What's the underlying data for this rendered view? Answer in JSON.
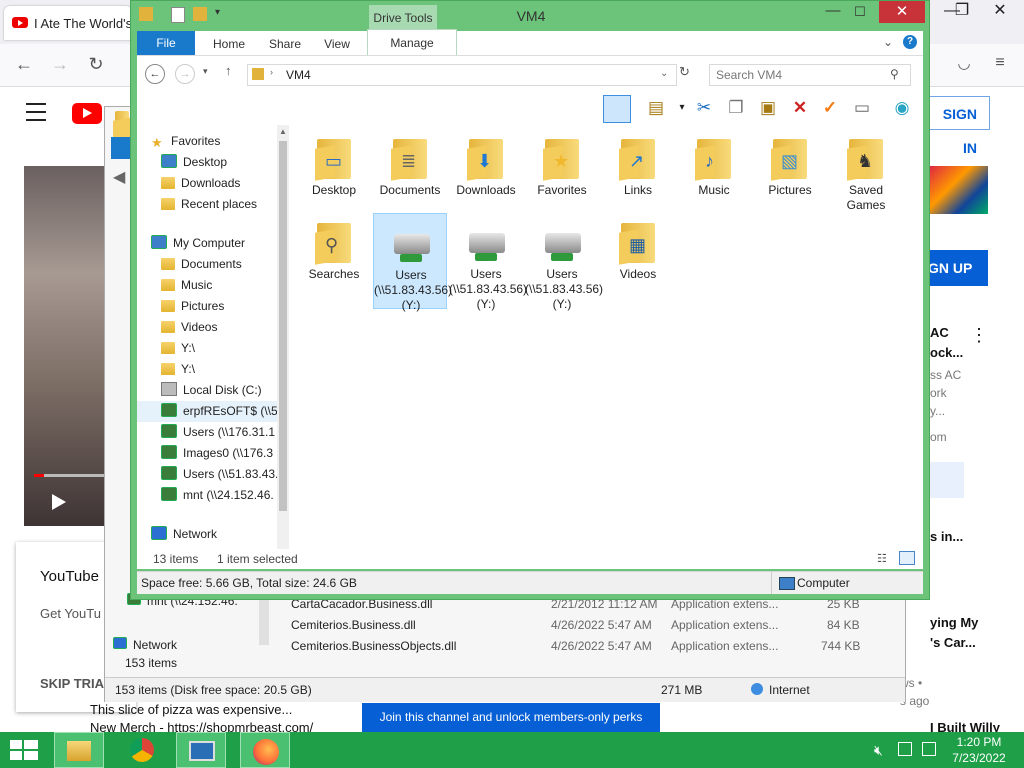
{
  "browser": {
    "tab_title": "I Ate The World's L",
    "sign_in": "SIGN IN",
    "sign_up": "GN UP",
    "side_text": {
      "t1": "AC",
      "t2": "ock...",
      "t3": "ss AC",
      "t4": "ork",
      "t5": "y...",
      "t6": "om",
      "t7": "s in...",
      "t8": "ying My",
      "t9": "'s Car...",
      "t10": "t",
      "t11": "ws •",
      "t12": "s ago",
      "t13": "I Built Willy"
    },
    "youtube_box": {
      "title": "YouTube",
      "subtitle": "Get YouTu",
      "skip": "SKIP TRIA"
    },
    "promo": "Join this channel and unlock members-only perks",
    "bottom_text": "This slice of pizza was expensive...",
    "bottom_text2": "New Merch - https://shopmrbeast.com/"
  },
  "ie_window": {
    "nav_items": [
      "mnt (\\\\24.152.46."
    ],
    "network": "Network",
    "items_count": "153 items",
    "files": [
      {
        "name": "CartaCacador.Business.dll",
        "date": "2/21/2012 11:12 AM",
        "type": "Application extens...",
        "size": "25 KB"
      },
      {
        "name": "Cemiterios.Business.dll",
        "date": "4/26/2022 5:47 AM",
        "type": "Application extens...",
        "size": "84 KB"
      },
      {
        "name": "Cemiterios.BusinessObjects.dll",
        "date": "4/26/2022 5:47 AM",
        "type": "Application extens...",
        "size": "744 KB"
      }
    ],
    "status_left": "153 items (Disk free space: 20.5 GB)",
    "status_size": "271 MB",
    "status_zone": "Internet"
  },
  "explorer": {
    "title": "VM4",
    "drive_tools": "Drive Tools",
    "ribbon_tabs": {
      "file": "File",
      "home": "Home",
      "share": "Share",
      "view": "View",
      "manage": "Manage"
    },
    "address": "VM4",
    "search_placeholder": "Search VM4",
    "nav": [
      {
        "label": "Favorites",
        "kind": "star",
        "indent": 0
      },
      {
        "label": "Desktop",
        "kind": "desk",
        "indent": 1
      },
      {
        "label": "Downloads",
        "kind": "folder",
        "indent": 1
      },
      {
        "label": "Recent places",
        "kind": "folder",
        "indent": 1
      },
      {
        "label": "",
        "kind": "gap",
        "indent": 0
      },
      {
        "label": "My Computer",
        "kind": "pc",
        "indent": 0
      },
      {
        "label": "Documents",
        "kind": "folder",
        "indent": 1
      },
      {
        "label": "Music",
        "kind": "folder",
        "indent": 1
      },
      {
        "label": "Pictures",
        "kind": "folder",
        "indent": 1
      },
      {
        "label": "Videos",
        "kind": "folder",
        "indent": 1
      },
      {
        "label": "Y:\\",
        "kind": "folder",
        "indent": 1
      },
      {
        "label": "Y:\\",
        "kind": "folder",
        "indent": 1
      },
      {
        "label": "Local Disk (C:)",
        "kind": "drive",
        "indent": 1
      },
      {
        "label": "erpfREsOFT$ (\\\\5",
        "kind": "net",
        "indent": 1
      },
      {
        "label": "Users (\\\\176.31.1",
        "kind": "net",
        "indent": 1
      },
      {
        "label": "Images0 (\\\\176.3",
        "kind": "net",
        "indent": 1
      },
      {
        "label": "Users (\\\\51.83.43.",
        "kind": "net",
        "indent": 1
      },
      {
        "label": "mnt (\\\\24.152.46.",
        "kind": "net",
        "indent": 1
      },
      {
        "label": "",
        "kind": "gap",
        "indent": 0
      },
      {
        "label": "Network",
        "kind": "network",
        "indent": 0
      }
    ],
    "items": [
      {
        "label": "Desktop",
        "kind": "desktop"
      },
      {
        "label": "Documents",
        "kind": "documents"
      },
      {
        "label": "Downloads",
        "kind": "downloads"
      },
      {
        "label": "Favorites",
        "kind": "favorites"
      },
      {
        "label": "Links",
        "kind": "links"
      },
      {
        "label": "Music",
        "kind": "music"
      },
      {
        "label": "Pictures",
        "kind": "pictures"
      },
      {
        "label": "Saved Games",
        "kind": "games"
      },
      {
        "label": "Searches",
        "kind": "searches"
      },
      {
        "label": "Users (\\\\51.83.43.56) (Y:)",
        "kind": "netdrive",
        "selected": true
      },
      {
        "label": "Users (\\\\51.83.43.56) (Y:)",
        "kind": "netdrive"
      },
      {
        "label": "Users (\\\\51.83.43.56) (Y:)",
        "kind": "netdrive"
      },
      {
        "label": "Videos",
        "kind": "videos"
      }
    ],
    "count_text": "13 items",
    "selected_text": "1 item selected",
    "space_text": "Space free: 5.66 GB, Total size: 24.6 GB",
    "computer_text": "Computer"
  },
  "taskbar": {
    "time": "1:20 PM",
    "date": "7/23/2022",
    "accent": "#1e9f48"
  }
}
